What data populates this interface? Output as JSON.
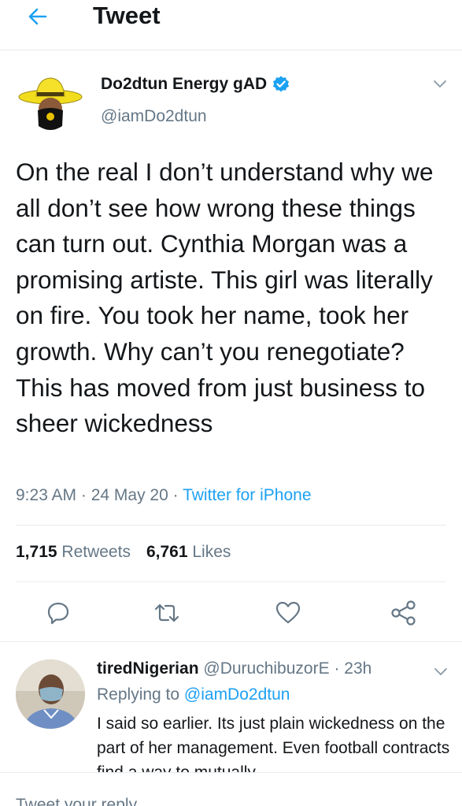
{
  "header": {
    "title": "Tweet",
    "back_icon": "back-arrow-icon"
  },
  "tweet": {
    "author_name": "Do2dtun Energy gAD",
    "author_handle": "@iamDo2dtun",
    "verified": true,
    "text": "On the real I don’t understand why we all don’t see how wrong these things can turn out. Cynthia Morgan was a promising artiste. This girl was literally on fire. You took her name, took her growth. Why can’t you renegotiate? This has moved from just business to sheer wickedness",
    "time": "9:23 AM",
    "date": "24 May 20",
    "source": "Twitter for iPhone",
    "retweets_count": "1,715",
    "retweets_label": "Retweets",
    "likes_count": "6,761",
    "likes_label": "Likes"
  },
  "actions": [
    "reply-icon",
    "retweet-icon",
    "like-icon",
    "share-icon"
  ],
  "reply": {
    "name": "tiredNigerian",
    "handle": "@DuruchibuzorE",
    "time": "23h",
    "replying_prefix": "Replying to",
    "replying_to": "@iamDo2dtun",
    "text": "I said so earlier. Its just plain wickedness on the part of her management. Even football contracts find a way to mutually"
  },
  "composer": {
    "placeholder": "Tweet your reply"
  },
  "colors": {
    "accent": "#1da1f2",
    "secondary_text": "#657786",
    "divider": "#e6ecf0"
  }
}
